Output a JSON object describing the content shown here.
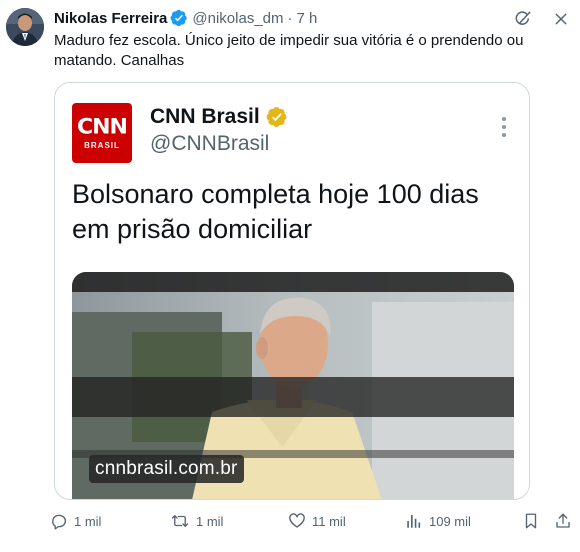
{
  "author": {
    "name": "Nikolas Ferreira",
    "handle": "@nikolas_dm",
    "separator": "·",
    "time": "7 h"
  },
  "tweet": {
    "text": "Maduro fez escola. Único jeito de impedir sua vitória é o prendendo ou matando. Canalhas"
  },
  "quoted": {
    "logo_text": "CNN",
    "logo_subtext": "BRASIL",
    "name": "CNN Brasil",
    "handle": "@CNNBrasil",
    "headline": "Bolsonaro completa hoje 100 dias em prisão domiciliar",
    "watermark": "cnnbrasil.com.br"
  },
  "actions": {
    "replies": "1 mil",
    "reposts": "1 mil",
    "likes": "11 mil",
    "views": "109 mil"
  },
  "colors": {
    "verified_blue": "#1d9bf0",
    "verified_gold": "#e2b719",
    "cnn_red": "#cc0000",
    "muted": "#536471"
  },
  "icons": [
    "grok-icon",
    "close-icon",
    "verified-badge-icon",
    "gold-verified-badge-icon",
    "more-icon",
    "reply-icon",
    "repost-icon",
    "like-icon",
    "views-icon",
    "bookmark-icon",
    "share-icon"
  ]
}
